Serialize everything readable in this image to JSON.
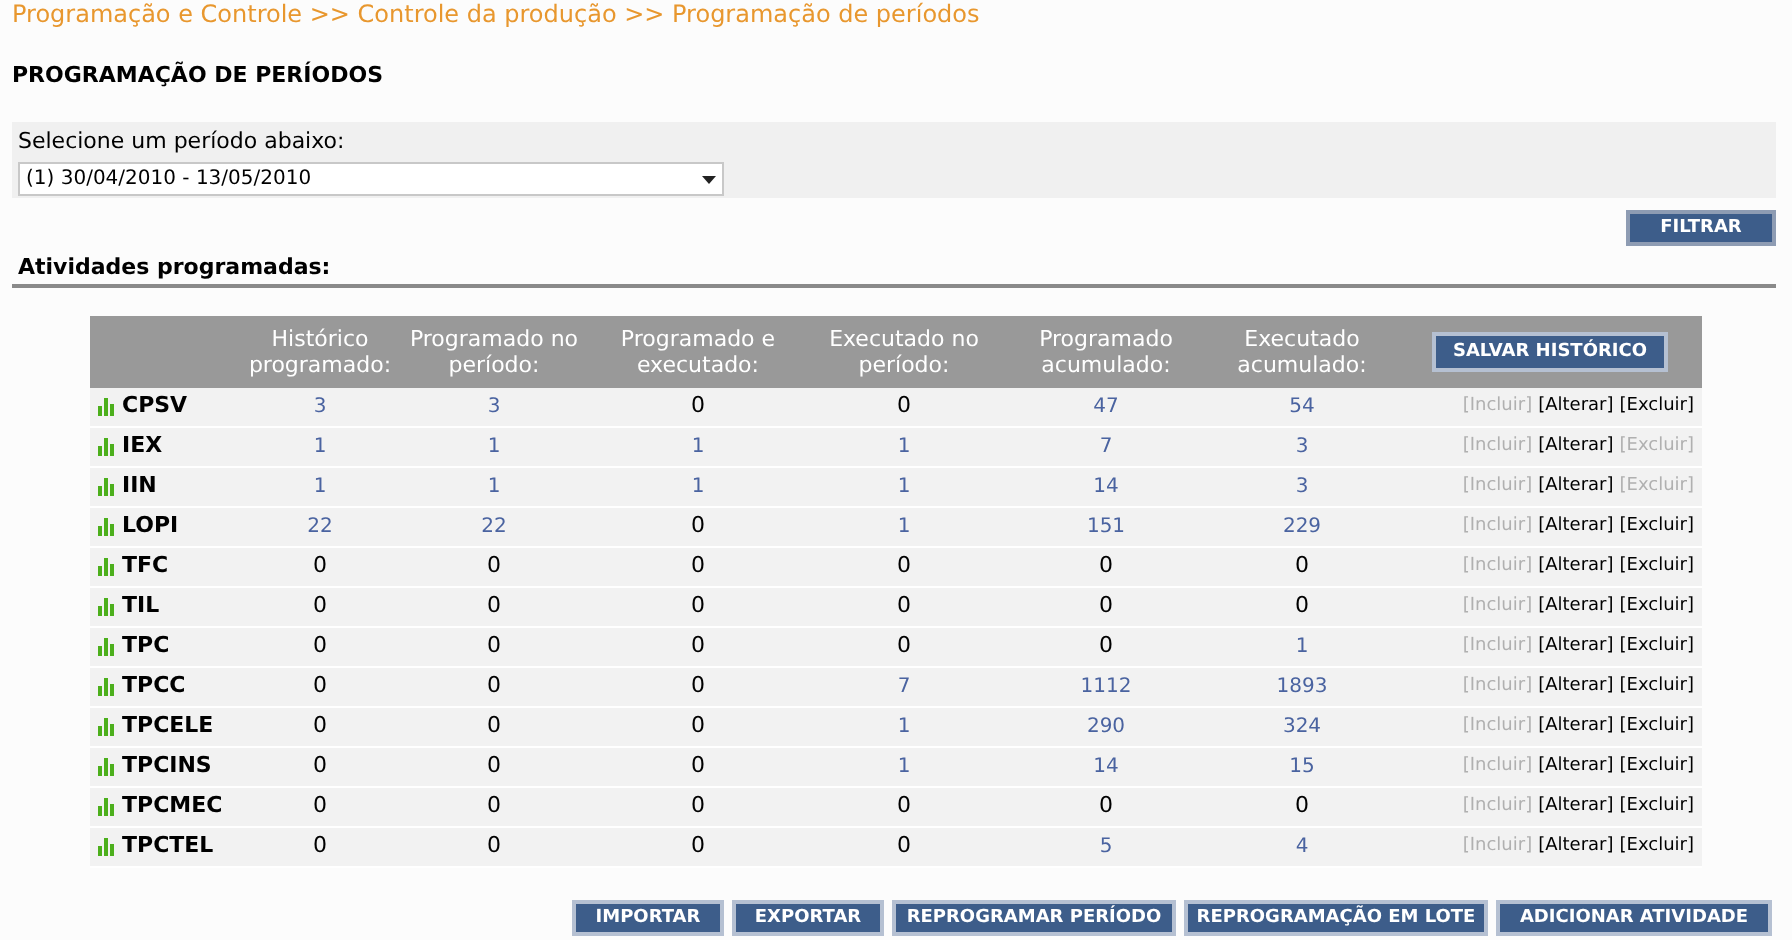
{
  "breadcrumb": "Programação e Controle >> Controle da produção >> Programação de períodos",
  "page_title": "PROGRAMAÇÃO DE PERÍODOS",
  "period_select": {
    "label": "Selecione um período abaixo:",
    "value": "(1) 30/04/2010 - 13/05/2010"
  },
  "filter_button": "FILTRAR",
  "section_title": "Atividades programadas:",
  "table": {
    "columns": [
      "Histórico programado:",
      "Programado no período:",
      "Programado e executado:",
      "Executado no período:",
      "Programado acumulado:",
      "Executado acumulado:"
    ],
    "header_button": "SALVAR HISTÓRICO",
    "rows": [
      {
        "name": "CPSV",
        "cells": [
          {
            "text": "3",
            "link": true
          },
          {
            "text": "3",
            "link": true
          },
          {
            "text": "0",
            "link": false
          },
          {
            "text": "0",
            "link": false
          },
          {
            "text": "47",
            "link": true
          },
          {
            "text": "54",
            "link": true
          }
        ],
        "actions": [
          {
            "label": "[Incluir]",
            "disabled": true
          },
          {
            "label": "[Alterar]",
            "disabled": false
          },
          {
            "label": "[Excluir]",
            "disabled": false
          }
        ]
      },
      {
        "name": "IEX",
        "cells": [
          {
            "text": "1",
            "link": true
          },
          {
            "text": "1",
            "link": true
          },
          {
            "text": "1",
            "link": true
          },
          {
            "text": "1",
            "link": true
          },
          {
            "text": "7",
            "link": true
          },
          {
            "text": "3",
            "link": true
          }
        ],
        "actions": [
          {
            "label": "[Incluir]",
            "disabled": true
          },
          {
            "label": "[Alterar]",
            "disabled": false
          },
          {
            "label": "[Excluir]",
            "disabled": true
          }
        ]
      },
      {
        "name": "IIN",
        "cells": [
          {
            "text": "1",
            "link": true
          },
          {
            "text": "1",
            "link": true
          },
          {
            "text": "1",
            "link": true
          },
          {
            "text": "1",
            "link": true
          },
          {
            "text": "14",
            "link": true
          },
          {
            "text": "3",
            "link": true
          }
        ],
        "actions": [
          {
            "label": "[Incluir]",
            "disabled": true
          },
          {
            "label": "[Alterar]",
            "disabled": false
          },
          {
            "label": "[Excluir]",
            "disabled": true
          }
        ]
      },
      {
        "name": "LOPI",
        "cells": [
          {
            "text": "22",
            "link": true
          },
          {
            "text": "22",
            "link": true
          },
          {
            "text": "0",
            "link": false
          },
          {
            "text": "1",
            "link": true
          },
          {
            "text": "151",
            "link": true
          },
          {
            "text": "229",
            "link": true
          }
        ],
        "actions": [
          {
            "label": "[Incluir]",
            "disabled": true
          },
          {
            "label": "[Alterar]",
            "disabled": false
          },
          {
            "label": "[Excluir]",
            "disabled": false
          }
        ]
      },
      {
        "name": "TFC",
        "cells": [
          {
            "text": "0",
            "link": false
          },
          {
            "text": "0",
            "link": false
          },
          {
            "text": "0",
            "link": false
          },
          {
            "text": "0",
            "link": false
          },
          {
            "text": "0",
            "link": false
          },
          {
            "text": "0",
            "link": false
          }
        ],
        "actions": [
          {
            "label": "[Incluir]",
            "disabled": true
          },
          {
            "label": "[Alterar]",
            "disabled": false
          },
          {
            "label": "[Excluir]",
            "disabled": false
          }
        ]
      },
      {
        "name": "TIL",
        "cells": [
          {
            "text": "0",
            "link": false
          },
          {
            "text": "0",
            "link": false
          },
          {
            "text": "0",
            "link": false
          },
          {
            "text": "0",
            "link": false
          },
          {
            "text": "0",
            "link": false
          },
          {
            "text": "0",
            "link": false
          }
        ],
        "actions": [
          {
            "label": "[Incluir]",
            "disabled": true
          },
          {
            "label": "[Alterar]",
            "disabled": false
          },
          {
            "label": "[Excluir]",
            "disabled": false
          }
        ]
      },
      {
        "name": "TPC",
        "cells": [
          {
            "text": "0",
            "link": false
          },
          {
            "text": "0",
            "link": false
          },
          {
            "text": "0",
            "link": false
          },
          {
            "text": "0",
            "link": false
          },
          {
            "text": "0",
            "link": false
          },
          {
            "text": "1",
            "link": true
          }
        ],
        "actions": [
          {
            "label": "[Incluir]",
            "disabled": true
          },
          {
            "label": "[Alterar]",
            "disabled": false
          },
          {
            "label": "[Excluir]",
            "disabled": false
          }
        ]
      },
      {
        "name": "TPCC",
        "cells": [
          {
            "text": "0",
            "link": false
          },
          {
            "text": "0",
            "link": false
          },
          {
            "text": "0",
            "link": false
          },
          {
            "text": "7",
            "link": true
          },
          {
            "text": "1112",
            "link": true
          },
          {
            "text": "1893",
            "link": true
          }
        ],
        "actions": [
          {
            "label": "[Incluir]",
            "disabled": true
          },
          {
            "label": "[Alterar]",
            "disabled": false
          },
          {
            "label": "[Excluir]",
            "disabled": false
          }
        ]
      },
      {
        "name": "TPCELE",
        "cells": [
          {
            "text": "0",
            "link": false
          },
          {
            "text": "0",
            "link": false
          },
          {
            "text": "0",
            "link": false
          },
          {
            "text": "1",
            "link": true
          },
          {
            "text": "290",
            "link": true
          },
          {
            "text": "324",
            "link": true
          }
        ],
        "actions": [
          {
            "label": "[Incluir]",
            "disabled": true
          },
          {
            "label": "[Alterar]",
            "disabled": false
          },
          {
            "label": "[Excluir]",
            "disabled": false
          }
        ]
      },
      {
        "name": "TPCINS",
        "cells": [
          {
            "text": "0",
            "link": false
          },
          {
            "text": "0",
            "link": false
          },
          {
            "text": "0",
            "link": false
          },
          {
            "text": "1",
            "link": true
          },
          {
            "text": "14",
            "link": true
          },
          {
            "text": "15",
            "link": true
          }
        ],
        "actions": [
          {
            "label": "[Incluir]",
            "disabled": true
          },
          {
            "label": "[Alterar]",
            "disabled": false
          },
          {
            "label": "[Excluir]",
            "disabled": false
          }
        ]
      },
      {
        "name": "TPCMEC",
        "cells": [
          {
            "text": "0",
            "link": false
          },
          {
            "text": "0",
            "link": false
          },
          {
            "text": "0",
            "link": false
          },
          {
            "text": "0",
            "link": false
          },
          {
            "text": "0",
            "link": false
          },
          {
            "text": "0",
            "link": false
          }
        ],
        "actions": [
          {
            "label": "[Incluir]",
            "disabled": true
          },
          {
            "label": "[Alterar]",
            "disabled": false
          },
          {
            "label": "[Excluir]",
            "disabled": false
          }
        ]
      },
      {
        "name": "TPCTEL",
        "cells": [
          {
            "text": "0",
            "link": false
          },
          {
            "text": "0",
            "link": false
          },
          {
            "text": "0",
            "link": false
          },
          {
            "text": "0",
            "link": false
          },
          {
            "text": "5",
            "link": true
          },
          {
            "text": "4",
            "link": true
          }
        ],
        "actions": [
          {
            "label": "[Incluir]",
            "disabled": true
          },
          {
            "label": "[Alterar]",
            "disabled": false
          },
          {
            "label": "[Excluir]",
            "disabled": false
          }
        ]
      }
    ]
  },
  "bottom_buttons": [
    "IMPORTAR",
    "EXPORTAR",
    "REPROGRAMAR PERÍODO",
    "REPROGRAMAÇÃO EM LOTE",
    "ADICIONAR ATIVIDADE"
  ]
}
